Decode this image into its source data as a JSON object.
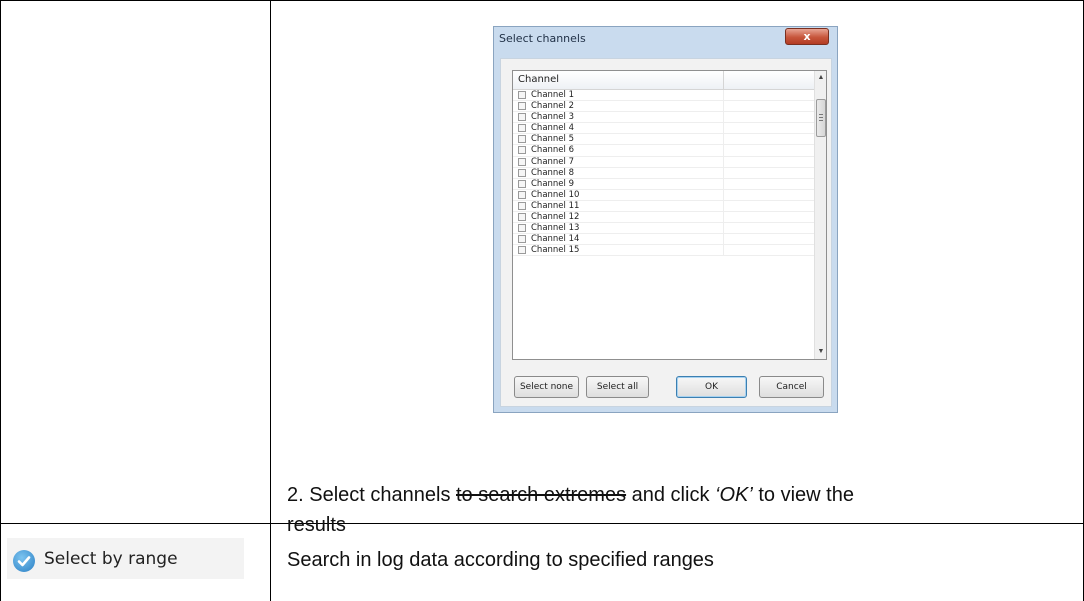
{
  "dialog": {
    "title": "Select channels",
    "close": "x",
    "column_header": "Channel",
    "channels": [
      "Channel 1",
      "Channel 2",
      "Channel 3",
      "Channel 4",
      "Channel 5",
      "Channel 6",
      "Channel 7",
      "Channel 8",
      "Channel 9",
      "Channel 10",
      "Channel 11",
      "Channel 12",
      "Channel 13",
      "Channel 14",
      "Channel 15"
    ],
    "buttons": {
      "select_none": "Select none",
      "select_all": "Select all",
      "ok": "OK",
      "cancel": "Cancel"
    }
  },
  "step2": {
    "prefix": "2. Select channels ",
    "strikethrough": "to search extremes",
    "middle": " and click ",
    "ok_quoted": "‘OK’",
    "suffix": " to view the results"
  },
  "select_by_range": {
    "label": "Select by range",
    "icon": "checkmark-circle-icon",
    "description": "Search in log data according to specified ranges"
  }
}
